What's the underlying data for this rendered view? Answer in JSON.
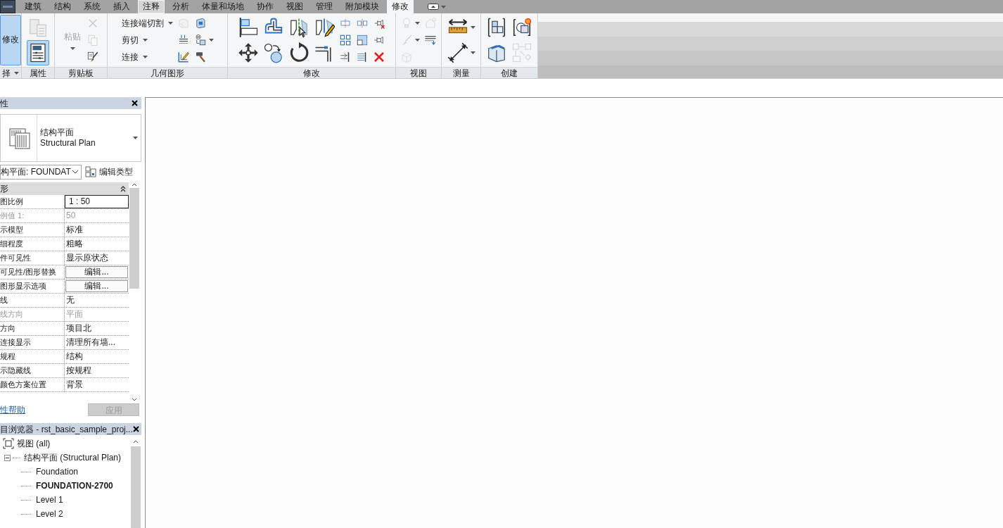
{
  "app_button": {
    "kind": "app"
  },
  "tabs": [
    {
      "label": "建筑",
      "selected": false,
      "hovered": false
    },
    {
      "label": "结构",
      "selected": false,
      "hovered": false
    },
    {
      "label": "系统",
      "selected": false,
      "hovered": false
    },
    {
      "label": "插入",
      "selected": false,
      "hovered": false
    },
    {
      "label": "注释",
      "selected": false,
      "hovered": true
    },
    {
      "label": "分析",
      "selected": false,
      "hovered": false
    },
    {
      "label": "体量和场地",
      "selected": false,
      "hovered": false
    },
    {
      "label": "协作",
      "selected": false,
      "hovered": false
    },
    {
      "label": "视图",
      "selected": false,
      "hovered": false
    },
    {
      "label": "管理",
      "selected": false,
      "hovered": false
    },
    {
      "label": "附加模块",
      "selected": false,
      "hovered": false
    },
    {
      "label": "修改",
      "selected": true,
      "hovered": false
    }
  ],
  "ribbon": {
    "panels": [
      {
        "title": "择",
        "dropdown": true,
        "tools": [
          {
            "kind": "big",
            "label": "修改",
            "selected": true,
            "disabled": false
          }
        ]
      },
      {
        "title": "属性",
        "tools": [
          {
            "kind": "medium",
            "disabled": true,
            "selected": false
          },
          {
            "kind": "medium",
            "disabled": false,
            "selected": true
          }
        ]
      },
      {
        "title": "剪贴板",
        "tools": [
          {
            "kind": "big",
            "label": "粘贴",
            "disabled": true,
            "selected": false,
            "dropdown": true
          },
          {
            "kind": "small",
            "disabled": true,
            "selected": false
          },
          {
            "kind": "small",
            "disabled": true,
            "selected": false
          },
          {
            "kind": "small",
            "disabled": false,
            "selected": false
          }
        ]
      },
      {
        "title": "几何图形",
        "tools": [
          {
            "kind": "small",
            "label": "连接端切割",
            "disabled": false,
            "selected": false,
            "dropdown": true
          },
          {
            "kind": "small",
            "label": "剪切",
            "disabled": false,
            "selected": false,
            "dropdown": true
          },
          {
            "kind": "small",
            "label": "连接",
            "disabled": false,
            "selected": false,
            "dropdown": true
          },
          {
            "kind": "small",
            "disabled": true,
            "selected": false
          },
          {
            "kind": "small",
            "disabled": false,
            "selected": false
          },
          {
            "kind": "small",
            "disabled": false,
            "selected": false
          },
          {
            "kind": "small",
            "disabled": false,
            "selected": false
          },
          {
            "kind": "small",
            "disabled": false,
            "selected": false,
            "dropdown": true
          },
          {
            "kind": "small",
            "disabled": false,
            "selected": false
          }
        ]
      },
      {
        "title": "修改",
        "tools": [
          {
            "kind": "medium",
            "disabled": false,
            "selected": false
          },
          {
            "kind": "medium",
            "disabled": false,
            "selected": false
          },
          {
            "kind": "medium",
            "disabled": false,
            "selected": false
          },
          {
            "kind": "medium",
            "disabled": false,
            "selected": false
          },
          {
            "kind": "medium",
            "disabled": false,
            "selected": false
          },
          {
            "kind": "medium",
            "disabled": false,
            "selected": false
          },
          {
            "kind": "medium",
            "disabled": false,
            "selected": false
          },
          {
            "kind": "medium",
            "disabled": false,
            "selected": false
          },
          {
            "kind": "small",
            "disabled": false,
            "selected": false
          },
          {
            "kind": "small",
            "disabled": false,
            "selected": false
          },
          {
            "kind": "small",
            "disabled": false,
            "selected": false
          },
          {
            "kind": "small",
            "disabled": false,
            "selected": false
          },
          {
            "kind": "small",
            "disabled": false,
            "selected": false
          },
          {
            "kind": "small",
            "disabled": false,
            "selected": false
          },
          {
            "kind": "small",
            "disabled": false,
            "selected": false
          },
          {
            "kind": "small",
            "disabled": false,
            "selected": false
          },
          {
            "kind": "small",
            "disabled": false,
            "selected": false
          }
        ]
      },
      {
        "title": "视图",
        "tools": [
          {
            "kind": "small",
            "disabled": true,
            "selected": false,
            "dropdown": true
          },
          {
            "kind": "small",
            "disabled": true,
            "selected": false,
            "dropdown": true
          },
          {
            "kind": "small",
            "disabled": true,
            "selected": false
          },
          {
            "kind": "small",
            "disabled": true,
            "selected": false
          },
          {
            "kind": "small",
            "disabled": false,
            "selected": false
          }
        ]
      },
      {
        "title": "测量",
        "tools": [
          {
            "kind": "medium",
            "disabled": false,
            "selected": false,
            "dropdown": true
          },
          {
            "kind": "medium",
            "disabled": false,
            "selected": false,
            "dropdown": true
          }
        ]
      },
      {
        "title": "创建",
        "tools": [
          {
            "kind": "medium",
            "disabled": false,
            "selected": false
          },
          {
            "kind": "medium",
            "disabled": false,
            "selected": false
          },
          {
            "kind": "medium",
            "disabled": false,
            "selected": false
          },
          {
            "kind": "medium",
            "disabled": true,
            "selected": false
          }
        ]
      }
    ]
  },
  "properties": {
    "title": "性",
    "type_name": "结构平面",
    "type_name_en": "Structural Plan",
    "instance": "构平面: FOUNDAT",
    "edit_type": "编辑类型",
    "group": "形",
    "rows": [
      {
        "name": "图比例",
        "value": "1 : 50",
        "kind": "field",
        "disabled": false
      },
      {
        "name": "例值 1:",
        "value": "50",
        "kind": "text",
        "disabled": true
      },
      {
        "name": "示模型",
        "value": "标准",
        "kind": "text",
        "disabled": false
      },
      {
        "name": "细程度",
        "value": "粗略",
        "kind": "text",
        "disabled": false
      },
      {
        "name": "件可见性",
        "value": "显示原状态",
        "kind": "text",
        "disabled": false
      },
      {
        "name": "可见性/图形替换",
        "value": "编辑...",
        "kind": "button",
        "disabled": false
      },
      {
        "name": "图形显示选项",
        "value": "编辑...",
        "kind": "button",
        "disabled": false
      },
      {
        "name": "线",
        "value": "无",
        "kind": "text",
        "disabled": false
      },
      {
        "name": "线方向",
        "value": "平面",
        "kind": "text",
        "disabled": true
      },
      {
        "name": "方向",
        "value": "项目北",
        "kind": "text",
        "disabled": false
      },
      {
        "name": "连接显示",
        "value": "清理所有墙...",
        "kind": "text",
        "disabled": false
      },
      {
        "name": "规程",
        "value": "结构",
        "kind": "text",
        "disabled": false
      },
      {
        "name": "示隐藏线",
        "value": "按规程",
        "kind": "text",
        "disabled": false
      },
      {
        "name": "颜色方案位置",
        "value": "背景",
        "kind": "text",
        "disabled": false
      }
    ],
    "help_link": "性帮助",
    "apply": {
      "label": "应用",
      "disabled": true
    }
  },
  "browser": {
    "title": "目浏览器 - rst_basic_sample_proj...",
    "tree": [
      {
        "label": "视图 (all)",
        "children": [
          {
            "label": "结构平面 (Structural Plan)",
            "expanded": true,
            "children": [
              {
                "label": "Foundation",
                "current": false
              },
              {
                "label": "FOUNDATION-2700",
                "current": true
              },
              {
                "label": "Level 1",
                "current": false
              },
              {
                "label": "Level 2",
                "current": false
              }
            ]
          }
        ]
      }
    ]
  }
}
